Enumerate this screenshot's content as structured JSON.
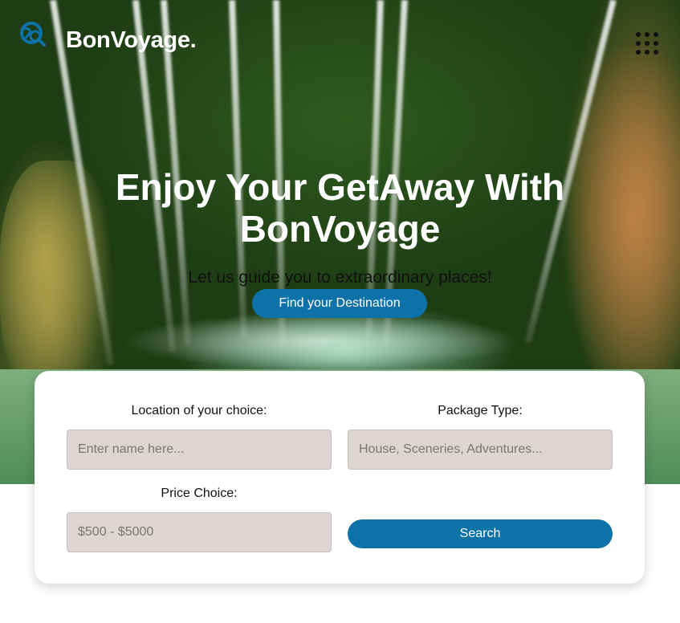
{
  "header": {
    "brand": "BonVoyage.",
    "logo_icon": "globe-search-icon",
    "menu_icon": "grid-menu-icon"
  },
  "hero": {
    "title": "Enjoy Your GetAway With BonVoyage",
    "subtitle": "Let us guide you to extraordinary places!",
    "cta_label": "Find your Destination"
  },
  "search": {
    "location_label": "Location of your choice:",
    "location_placeholder": "Enter name here...",
    "package_label": "Package Type:",
    "package_placeholder": "House, Sceneries, Adventures...",
    "price_label": "Price Choice:",
    "price_placeholder": "$500 - $5000",
    "search_label": "Search"
  },
  "colors": {
    "accent": "#0d72a8",
    "input_bg": "#ddd4d4"
  }
}
